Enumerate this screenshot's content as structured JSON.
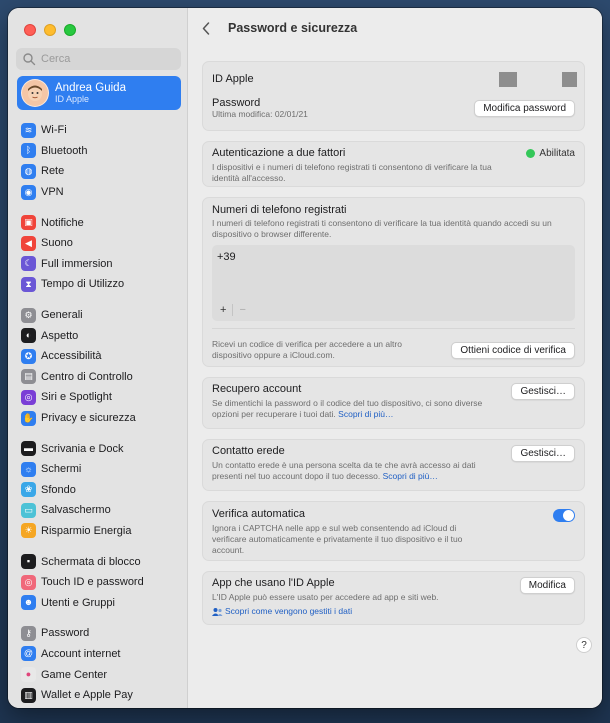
{
  "sidebar": {
    "search_placeholder": "Cerca",
    "account": {
      "name": "Andrea Guida",
      "subtitle": "ID Apple"
    },
    "groups": [
      [
        {
          "label": "Wi-Fi",
          "icon": "wifi-icon",
          "color": "#2f7ef0",
          "glyph": "≋"
        },
        {
          "label": "Bluetooth",
          "icon": "bluetooth-icon",
          "color": "#2f7ef0",
          "glyph": "ᛒ"
        },
        {
          "label": "Rete",
          "icon": "network-icon",
          "color": "#2f7ef0",
          "glyph": "◍"
        },
        {
          "label": "VPN",
          "icon": "vpn-icon",
          "color": "#2f7ef0",
          "glyph": "◉"
        }
      ],
      [
        {
          "label": "Notifiche",
          "icon": "notifications-icon",
          "color": "#f0443a",
          "glyph": "▣"
        },
        {
          "label": "Suono",
          "icon": "sound-icon",
          "color": "#f0443a",
          "glyph": "◀"
        },
        {
          "label": "Full immersion",
          "icon": "focus-icon",
          "color": "#6b57d6",
          "glyph": "☾"
        },
        {
          "label": "Tempo di Utilizzo",
          "icon": "screen-time-icon",
          "color": "#6b57d6",
          "glyph": "⧗"
        }
      ],
      [
        {
          "label": "Generali",
          "icon": "gear-icon",
          "color": "#8e8e93",
          "glyph": "⚙"
        },
        {
          "label": "Aspetto",
          "icon": "appearance-icon",
          "color": "#1d1d1f",
          "glyph": "◐"
        },
        {
          "label": "Accessibilità",
          "icon": "accessibility-icon",
          "color": "#2f7ef0",
          "glyph": "✪"
        },
        {
          "label": "Centro di Controllo",
          "icon": "control-center-icon",
          "color": "#8e8e93",
          "glyph": "▤"
        },
        {
          "label": "Siri e Spotlight",
          "icon": "siri-icon",
          "color": "#7a3ed6",
          "glyph": "◎"
        },
        {
          "label": "Privacy e sicurezza",
          "icon": "privacy-icon",
          "color": "#2f7ef0",
          "glyph": "✋"
        }
      ],
      [
        {
          "label": "Scrivania e Dock",
          "icon": "desktop-dock-icon",
          "color": "#1d1d1f",
          "glyph": "▬"
        },
        {
          "label": "Schermi",
          "icon": "displays-icon",
          "color": "#2f7ef0",
          "glyph": "☼"
        },
        {
          "label": "Sfondo",
          "icon": "wallpaper-icon",
          "color": "#3aa7e8",
          "glyph": "❀"
        },
        {
          "label": "Salvaschermo",
          "icon": "screensaver-icon",
          "color": "#4cc2d6",
          "glyph": "▭"
        },
        {
          "label": "Risparmio Energia",
          "icon": "energy-icon",
          "color": "#f5a623",
          "glyph": "☀"
        }
      ],
      [
        {
          "label": "Schermata di blocco",
          "icon": "lock-screen-icon",
          "color": "#1d1d1f",
          "glyph": "▪"
        },
        {
          "label": "Touch ID e password",
          "icon": "touch-id-icon",
          "color": "#f0687a",
          "glyph": "◎"
        },
        {
          "label": "Utenti e Gruppi",
          "icon": "users-icon",
          "color": "#2f7ef0",
          "glyph": "☻"
        }
      ],
      [
        {
          "label": "Password",
          "icon": "key-icon",
          "color": "#8e8e93",
          "glyph": "⚷"
        },
        {
          "label": "Account internet",
          "icon": "at-icon",
          "color": "#2f7ef0",
          "glyph": "@"
        },
        {
          "label": "Game Center",
          "icon": "game-center-icon",
          "color": "#e8e8e8",
          "glyph": "●"
        },
        {
          "label": "Wallet e Apple Pay",
          "icon": "wallet-icon",
          "color": "#1d1d1f",
          "glyph": "▥"
        }
      ]
    ]
  },
  "header": {
    "title": "Password e sicurezza"
  },
  "apple_id": {
    "label": "ID Apple"
  },
  "password": {
    "label": "Password",
    "subtitle": "Ultima modifica: 02/01/21",
    "button": "Modifica password"
  },
  "two_factor": {
    "title": "Autenticazione a due fattori",
    "status": "Abilitata",
    "desc": "I dispositivi e i numeri di telefono registrati ti consentono di verificare la tua identità all'accesso."
  },
  "phones": {
    "title": "Numeri di telefono registrati",
    "desc": "I numeri di telefono registrati ti consentono di verificare la tua identità quando accedi su un dispositivo o browser differente.",
    "number": "+39",
    "add": "+",
    "remove": "−",
    "code_desc": "Ricevi un codice di verifica per accedere a un altro dispositivo oppure a iCloud.com.",
    "code_button": "Ottieni codice di verifica"
  },
  "recovery": {
    "title": "Recupero account",
    "desc": "Se dimentichi la password o il codice del tuo dispositivo, ci sono diverse opzioni per recuperare i tuoi dati.",
    "link": "Scopri di più…",
    "button": "Gestisci…"
  },
  "legacy": {
    "title": "Contatto erede",
    "desc": "Un contatto erede è una persona scelta da te che avrà accesso ai dati presenti nel tuo account dopo il tuo decesso.",
    "link": "Scopri di più…",
    "button": "Gestisci…"
  },
  "auto_verify": {
    "title": "Verifica automatica",
    "desc": "Ignora i CAPTCHA nelle app e sul web consentendo ad iCloud di verificare automaticamente e privatamente il tuo dispositivo e il tuo account.",
    "enabled": true
  },
  "apps": {
    "title": "App che usano l'ID Apple",
    "desc": "L'ID Apple può essere usato per accedere ad app e siti web.",
    "link": "Scopri come vengono gestiti i dati",
    "button": "Modifica"
  },
  "help": "?"
}
